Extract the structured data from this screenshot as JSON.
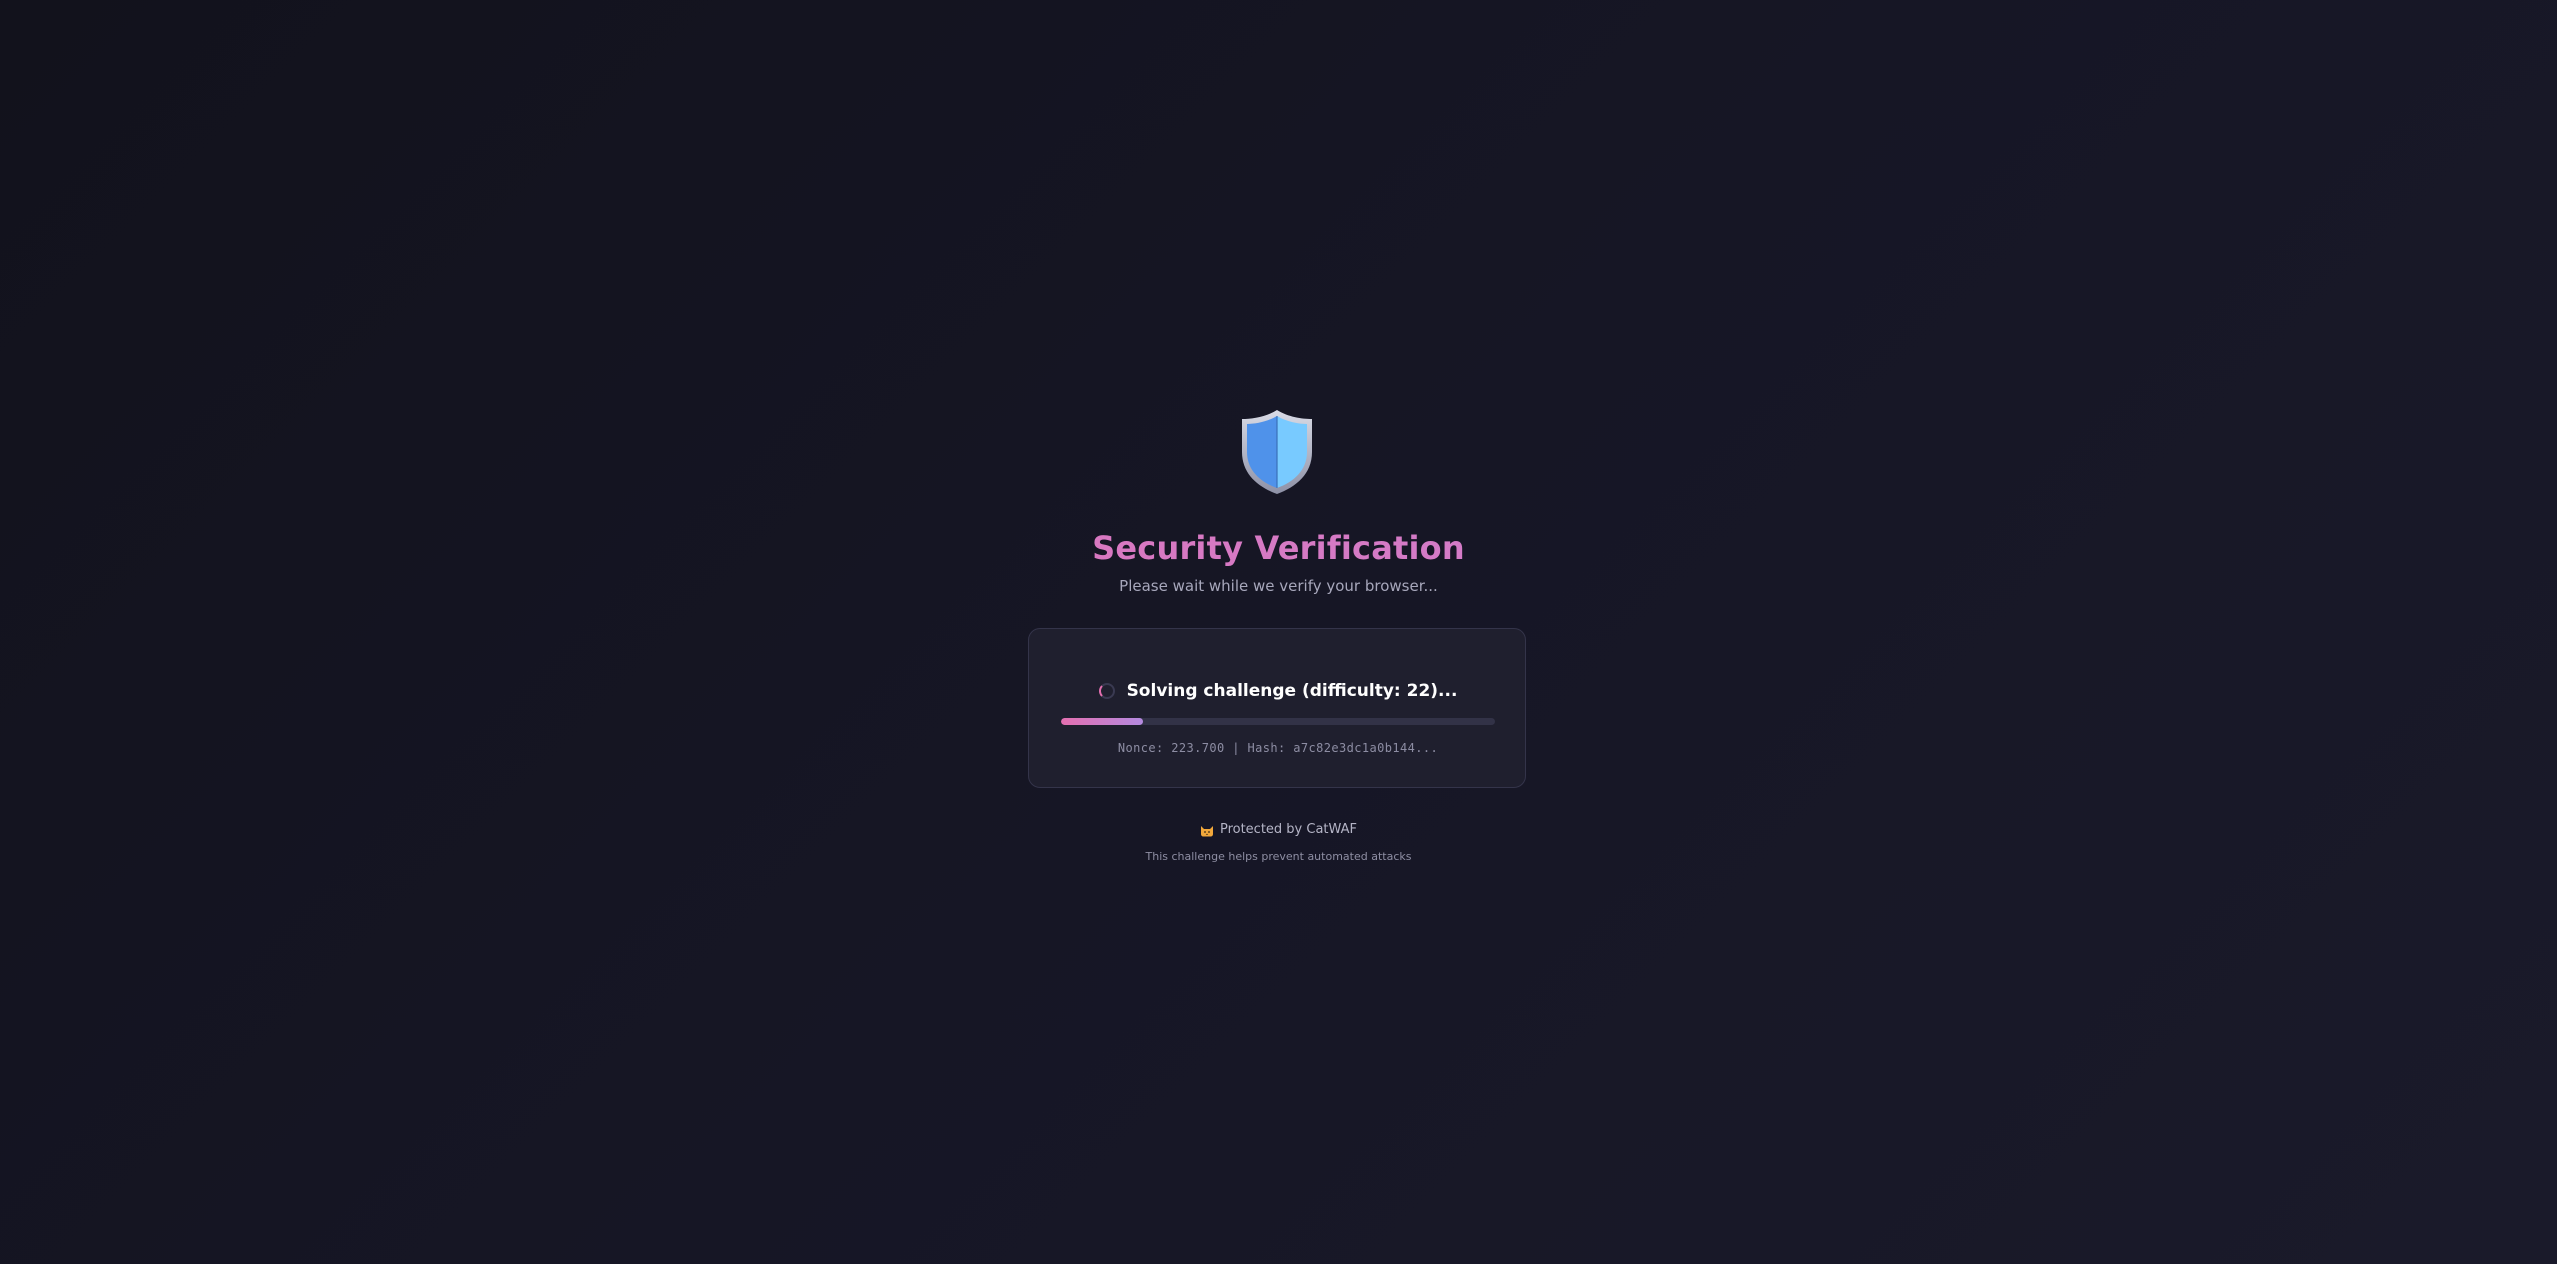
{
  "header": {
    "icon": "shield-icon",
    "title": "Security Verification",
    "subtitle": "Please wait while we verify your browser..."
  },
  "challenge": {
    "status_text": "Solving challenge (difficulty: 22)...",
    "progress_fraction": 0.19,
    "nonce_text": "Nonce: 223.700 | Hash: a7c82e3dc1a0b144...",
    "spinner_icon": "loading-spinner-icon"
  },
  "footer": {
    "icon": "cat-icon",
    "protected_by": "Protected by CatWAF",
    "note": "This challenge helps prevent automated attacks"
  },
  "colors": {
    "background": "#161625",
    "accent_pink": "#e46fb0",
    "accent_purple": "#b48ae0",
    "shield_left": "#4f92ea",
    "shield_right": "#78caff"
  }
}
